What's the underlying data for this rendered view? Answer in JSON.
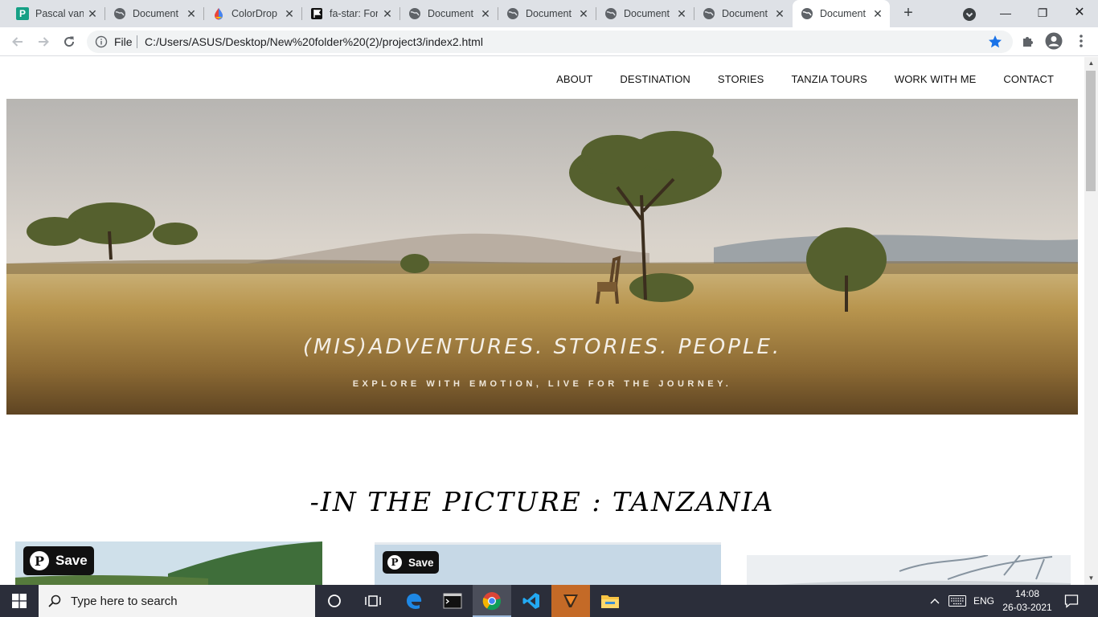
{
  "browser": {
    "tabs": [
      {
        "title": "Pascal van",
        "favicon": "p-letter-icon",
        "active": false
      },
      {
        "title": "Document",
        "favicon": "globe-icon",
        "active": false
      },
      {
        "title": "ColorDrop",
        "favicon": "drop-icon",
        "active": false
      },
      {
        "title": "fa-star: For",
        "favicon": "flag-icon",
        "active": false
      },
      {
        "title": "Document",
        "favicon": "globe-icon",
        "active": false
      },
      {
        "title": "Document",
        "favicon": "globe-icon",
        "active": false
      },
      {
        "title": "Document",
        "favicon": "globe-icon",
        "active": false
      },
      {
        "title": "Document",
        "favicon": "globe-icon",
        "active": false
      },
      {
        "title": "Document",
        "favicon": "globe-icon",
        "active": true
      }
    ],
    "new_tab": "+",
    "address": {
      "scheme_label": "File",
      "url": "C:/Users/ASUS/Desktop/New%20folder%20(2)/project3/index2.html"
    },
    "window_controls": {
      "minimize": "—",
      "restore": "❐",
      "close": "✕"
    }
  },
  "site": {
    "nav": [
      "ABOUT",
      "DESTINATION",
      "STORIES",
      "TANZIA TOURS",
      "WORK WITH ME",
      "CONTACT"
    ],
    "hero": {
      "title": "(MIS)ADVENTURES. STORIES. PEOPLE.",
      "subtitle": "EXPLORE WITH EMOTION, LIVE FOR THE JOURNEY."
    },
    "section_title": "-IN THE PICTURE : TANZANIA",
    "save_buttons": [
      "Save",
      "Save"
    ]
  },
  "taskbar": {
    "search_placeholder": "Type here to search",
    "language": "ENG",
    "time": "14:08",
    "date": "26-03-2021"
  },
  "colors": {
    "tabstrip": "#dee1e6",
    "accent_star": "#1a73e8",
    "taskbar": "#2b2e3a"
  }
}
